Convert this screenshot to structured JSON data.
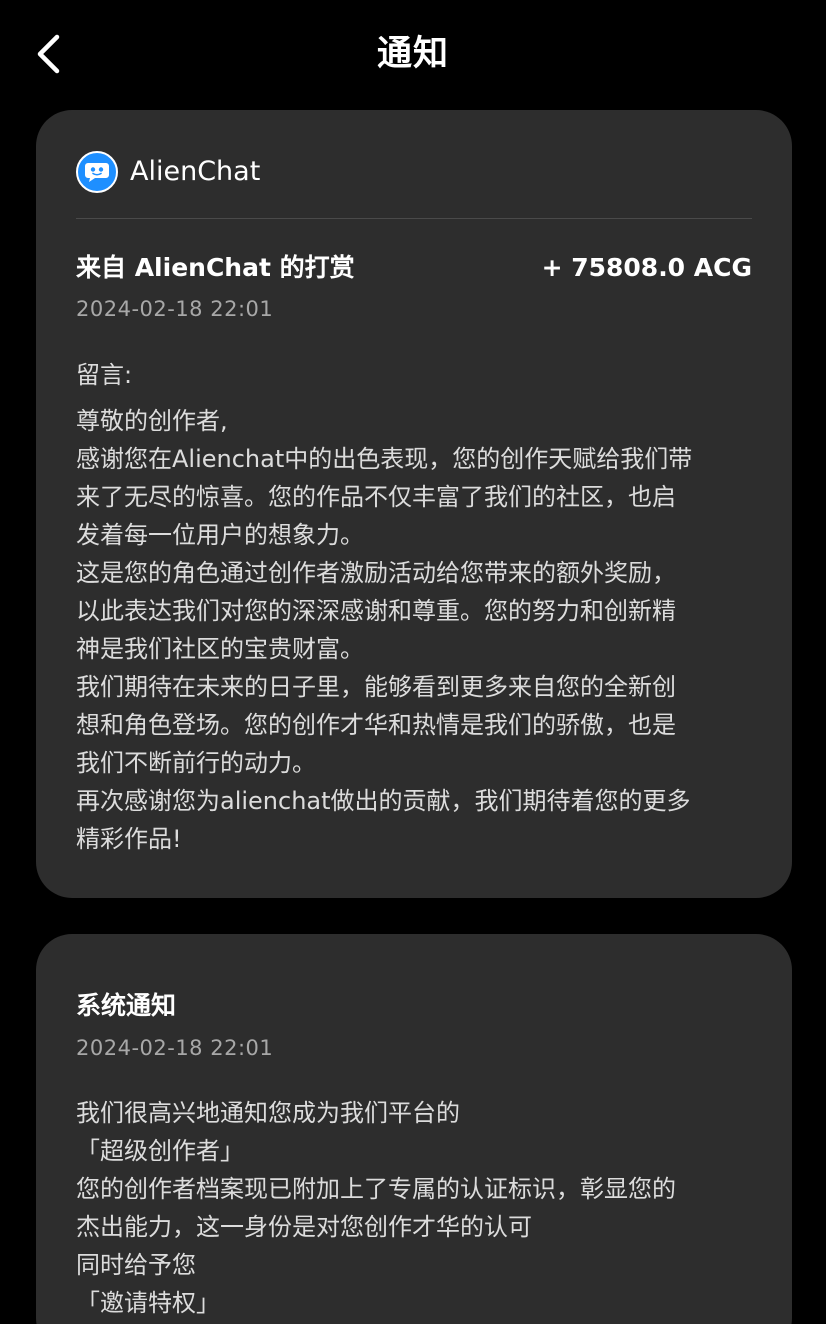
{
  "header": {
    "title": "通知",
    "back_icon": "chevron-left-icon"
  },
  "notifications": [
    {
      "sender": {
        "name": "AlienChat",
        "avatar_icon": "alienchat-logo-icon",
        "avatar_color": "#1e8fff"
      },
      "title": "来自 AlienChat 的打赏",
      "amount": "+ 75808.0 ACG",
      "timestamp": "2024-02-18 22:01",
      "message_label": "留言:",
      "message_lines": [
        "尊敬的创作者,",
        "感谢您在Alienchat中的出色表现，您的创作天赋给我们带",
        "来了无尽的惊喜。您的作品不仅丰富了我们的社区，也启",
        "发着每一位用户的想象力。",
        "这是您的角色通过创作者激励活动给您带来的额外奖励，",
        "以此表达我们对您的深深感谢和尊重。您的努力和创新精",
        "神是我们社区的宝贵财富。",
        "我们期待在未来的日子里，能够看到更多来自您的全新创",
        "想和角色登场。您的创作才华和热情是我们的骄傲，也是",
        "我们不断前行的动力。",
        "再次感谢您为alienchat做出的贡献，我们期待着您的更多",
        "精彩作品!"
      ]
    },
    {
      "title": "系统通知",
      "timestamp": "2024-02-18 22:01",
      "message_lines": [
        "我们很高兴地通知您成为我们平台的",
        "「超级创作者」",
        "您的创作者档案现已附加上了专属的认证标识，彰显您的",
        "杰出能力，这一身份是对您创作才华的认可",
        "同时给予您",
        "「邀请特权」"
      ]
    }
  ],
  "colors": {
    "background": "#000000",
    "card": "#2d2d2d",
    "divider": "#4a4a4a",
    "timestamp": "#a8a8a8",
    "body_text": "#dcdcdc"
  }
}
